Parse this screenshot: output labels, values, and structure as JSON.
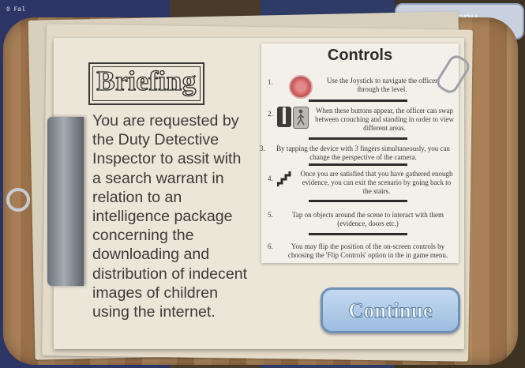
{
  "hud": {
    "debug": "0 Fal"
  },
  "tab": {
    "label": "Menu"
  },
  "briefing": {
    "title": "Briefing",
    "lines": [
      "You are requested by",
      "the Duty Detective",
      "Inspector to assit with",
      "a search warrant in",
      "relation to an",
      "intelligence package",
      "concerning the",
      "downloading and",
      "distribution of indecent",
      "images of children",
      "using the internet."
    ]
  },
  "controls": {
    "title": "Controls",
    "items": [
      {
        "num": "1.",
        "text": "Use the Joystick to navigate the officer through the level.",
        "icon": "joystick-icon"
      },
      {
        "num": "2.",
        "text": "When these buttons appear, the officer can swap between crouching and standing in order to view different areas.",
        "icon": "stance-buttons-icon"
      },
      {
        "num": "3.",
        "text": "By tapping the device with 3 fingers simultaneously, you can change the perspective of the camera.",
        "icon": ""
      },
      {
        "num": "4.",
        "text": "Once you are satisfied that you have gathered enough evidence, you can exit the scenario by going back to the stairs.",
        "icon": "stairs-icon"
      },
      {
        "num": "5.",
        "text": "Tap on objects around the scene to interact with them (evidence, doors etc.)",
        "icon": ""
      },
      {
        "num": "6.",
        "text": "You may flip the position of the on-screen controls by choosing the 'Flip Controls' option in the in game menu.",
        "icon": ""
      }
    ]
  },
  "continue": {
    "label": "Continue"
  },
  "colors": {
    "accent": "#9cbde0",
    "paper": "#ece6d8",
    "ink": "#3c3a38"
  }
}
